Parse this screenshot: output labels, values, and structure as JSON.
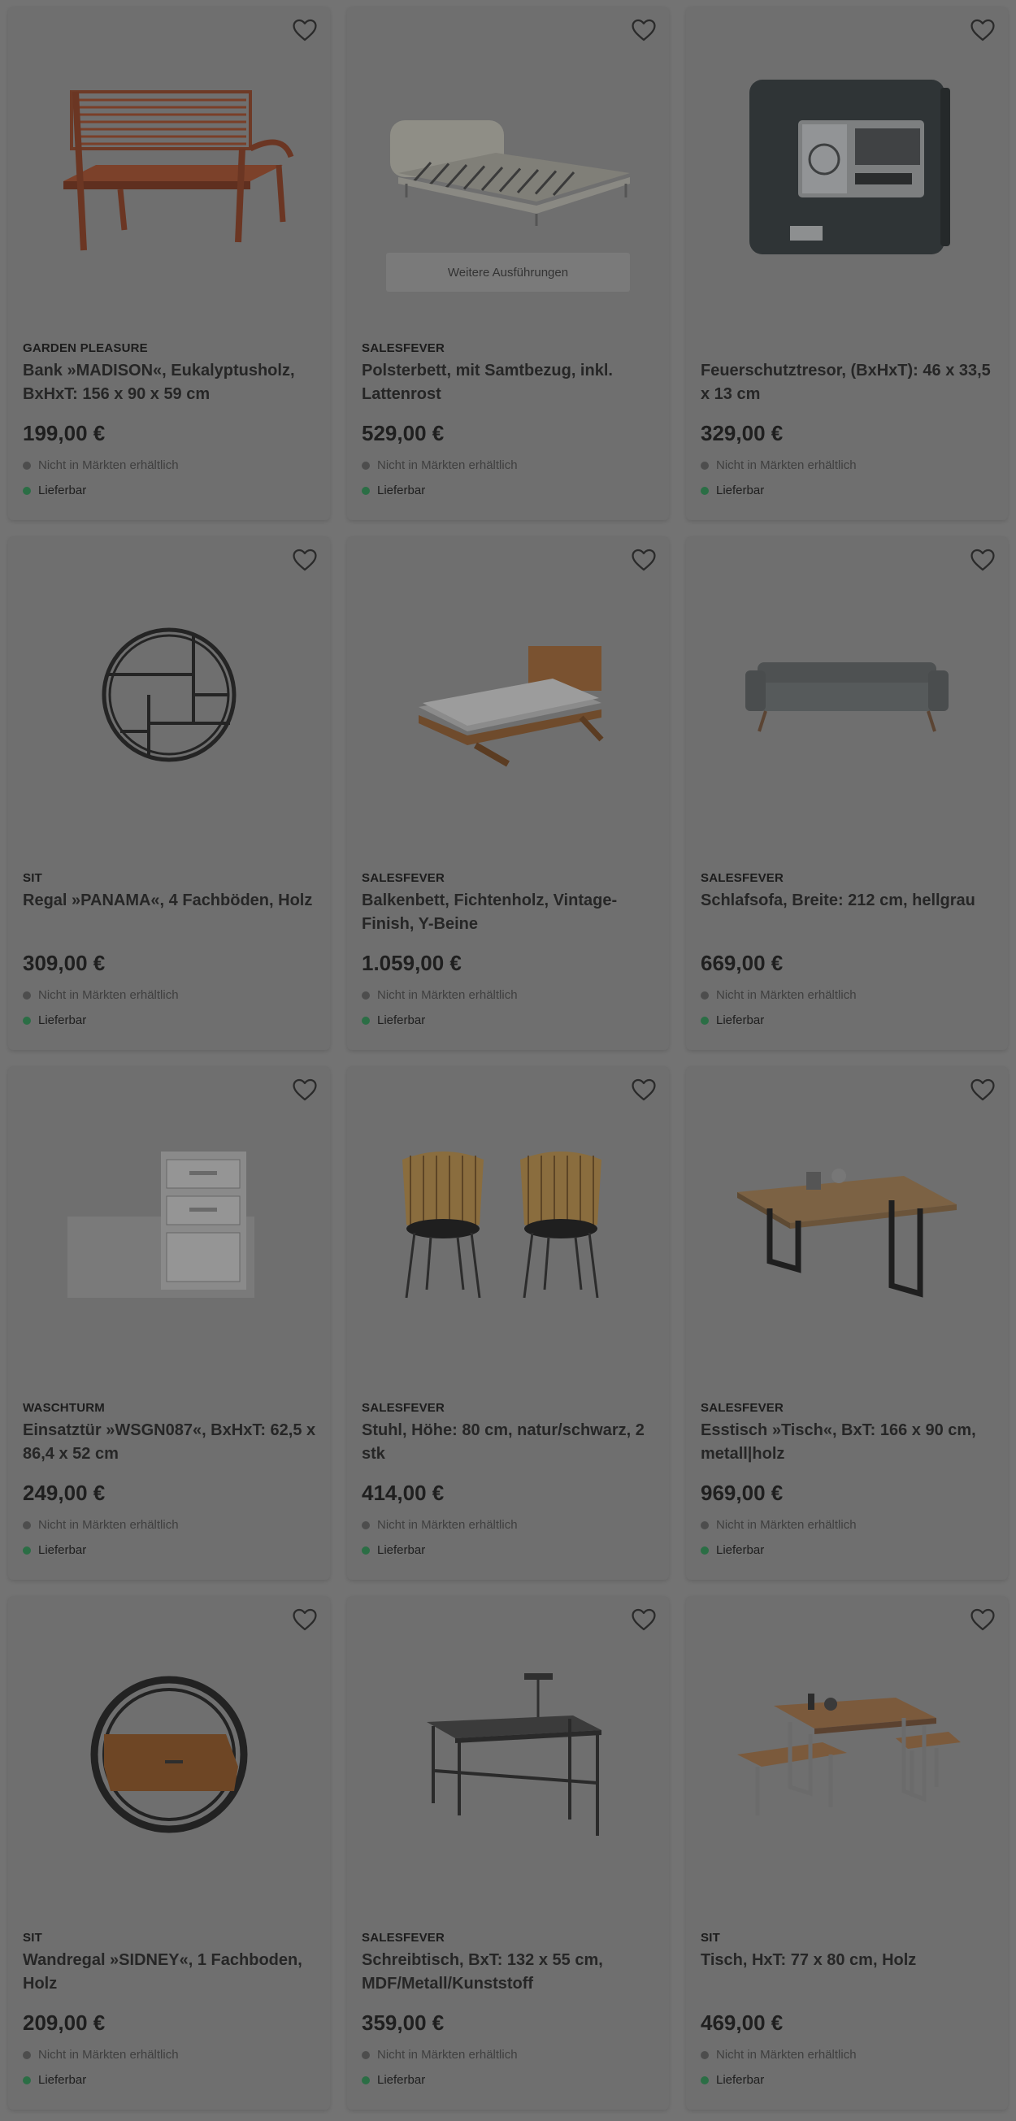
{
  "colors": {
    "overlay_background": "#737373",
    "card_background": "#6f6f6f",
    "available_dot": "#2b6e45",
    "store_dot": "#4d4d4d"
  },
  "store_availability_label": "Nicht in Märkten erhältlich",
  "delivery_label": "Lieferbar",
  "wishlist_icon": "heart-outline-icon",
  "products": [
    {
      "brand": "GARDEN PLEASURE",
      "title": "Bank »MADISON«, Eukalyptusholz, BxHxT: 156 x 90 x 59 cm",
      "price": "199,00 €",
      "image": "bench"
    },
    {
      "brand": "SALESFEVER",
      "title": "Polsterbett, mit Samtbezug, inkl. Lattenrost",
      "price": "529,00 €",
      "image": "upholstered-bed",
      "variants_label": "Weitere Ausführungen"
    },
    {
      "brand": "",
      "title": "Feuerschutztresor, (BxHxT): 46 x 33,5 x 13 cm",
      "price": "329,00 €",
      "image": "safe"
    },
    {
      "brand": "SIT",
      "title": "Regal »PANAMA«, 4 Fachböden, Holz",
      "price": "309,00 €",
      "image": "round-shelf"
    },
    {
      "brand": "SALESFEVER",
      "title": "Balkenbett, Fichtenholz, Vintage-Finish, Y-Beine",
      "price": "1.059,00 €",
      "image": "wooden-bed"
    },
    {
      "brand": "SALESFEVER",
      "title": "Schlafsofa, Breite: 212 cm, hellgrau",
      "price": "669,00 €",
      "image": "sofa"
    },
    {
      "brand": "WASCHTURM",
      "title": "Einsatztür »WSGN087«, BxHxT: 62,5 x 86,4 x 52 cm",
      "price": "249,00 €",
      "image": "cabinet"
    },
    {
      "brand": "SALESFEVER",
      "title": "Stuhl, Höhe: 80 cm, natur/schwarz, 2 stk",
      "price": "414,00 €",
      "image": "chairs"
    },
    {
      "brand": "SALESFEVER",
      "title": "Esstisch »Tisch«, BxT: 166 x 90 cm, metall|holz",
      "price": "969,00 €",
      "image": "dining-table"
    },
    {
      "brand": "SIT",
      "title": "Wandregal »SIDNEY«, 1 Fachboden, Holz",
      "price": "209,00 €",
      "image": "wall-shelf"
    },
    {
      "brand": "SALESFEVER",
      "title": "Schreibtisch, BxT: 132 x 55 cm, MDF/Metall/Kunststoff",
      "price": "359,00 €",
      "image": "desk"
    },
    {
      "brand": "SIT",
      "title": "Tisch, HxT: 77 x 80 cm, Holz",
      "price": "469,00 €",
      "image": "table-bench-set"
    }
  ]
}
